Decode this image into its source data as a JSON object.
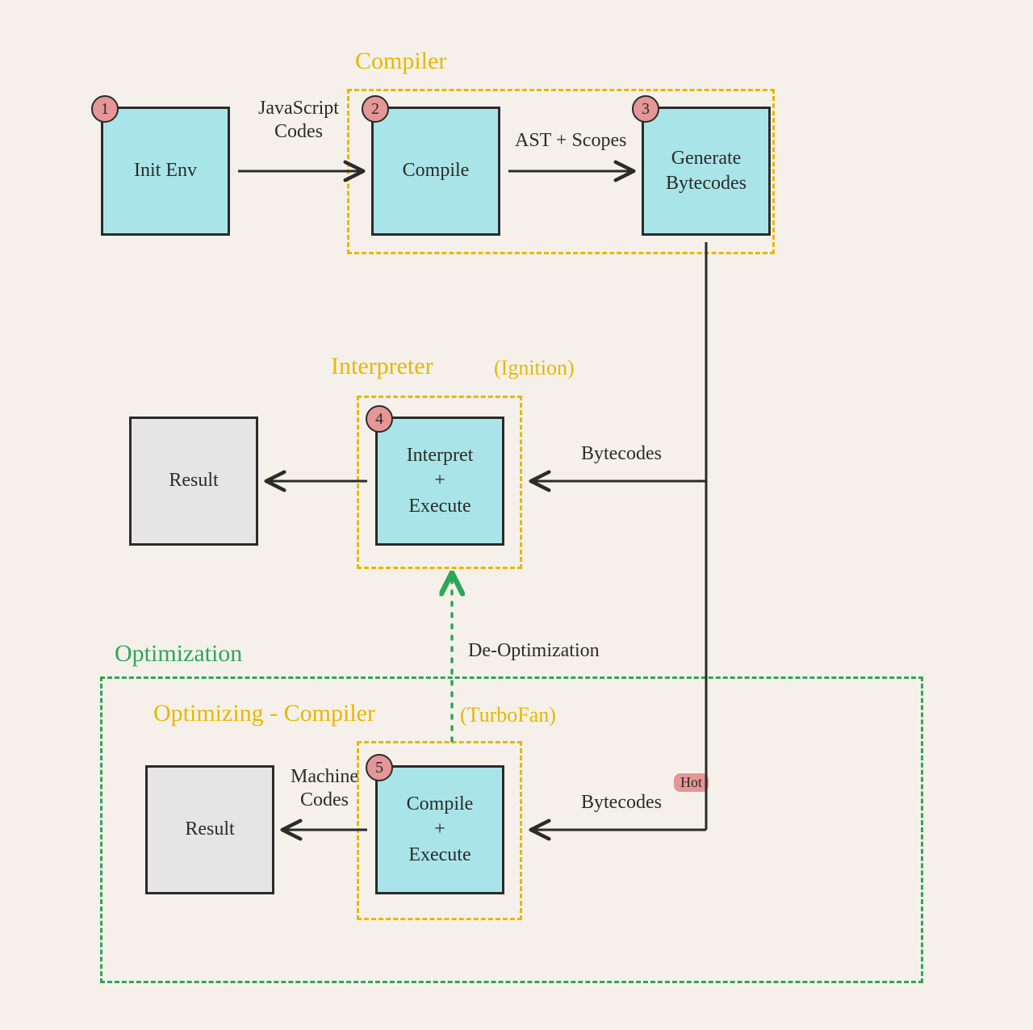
{
  "groups": {
    "compiler": {
      "title": "Compiler"
    },
    "interpreter": {
      "title": "Interpreter",
      "note": "(Ignition)"
    },
    "optimizing": {
      "title": "Optimizing - Compiler",
      "note": "(TurboFan)"
    },
    "optimization": {
      "title": "Optimization"
    }
  },
  "nodes": {
    "init_env": {
      "num": "1",
      "label": "Init Env"
    },
    "compile": {
      "num": "2",
      "label": "Compile"
    },
    "gen_bytecodes": {
      "num": "3",
      "label": "Generate\nBytecodes"
    },
    "interpret_exec": {
      "num": "4",
      "label": "Interpret\n+\nExecute"
    },
    "compile_exec": {
      "num": "5",
      "label": "Compile\n+\nExecute"
    },
    "result_top": {
      "label": "Result"
    },
    "result_bottom": {
      "label": "Result"
    }
  },
  "edges": {
    "js_codes": "JavaScript\nCodes",
    "ast_scopes": "AST + Scopes",
    "bytecodes1": "Bytecodes",
    "bytecodes2": "Bytecodes",
    "hot": "Hot",
    "machine": "Machine\nCodes",
    "deopt": "De-Optimization"
  },
  "colors": {
    "yellow": "#e8b700",
    "green": "#2fa55a",
    "blue": "#a9e5e8",
    "pink": "#e59696",
    "stroke": "#2b2b2b"
  }
}
